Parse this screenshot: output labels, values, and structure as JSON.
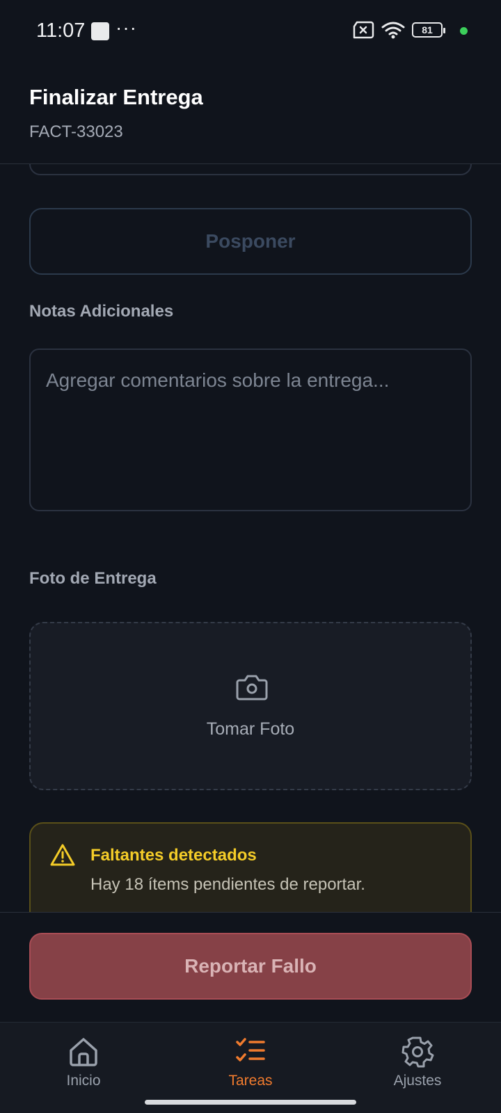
{
  "status_bar": {
    "time": "11:07",
    "dots": "···",
    "battery_level": "81",
    "icons": [
      "notification-square-icon",
      "sim-off-icon",
      "wifi-icon",
      "battery-icon",
      "dot-indicator-icon"
    ]
  },
  "header": {
    "title": "Finalizar Entrega",
    "subtitle": "FACT-33023"
  },
  "main": {
    "postpone_label": "Posponer",
    "notes": {
      "label": "Notas Adicionales",
      "placeholder": "Agregar comentarios sobre la entrega...",
      "value": ""
    },
    "photo": {
      "label": "Foto de Entrega",
      "button_label": "Tomar Foto",
      "icon": "camera-icon"
    },
    "warning": {
      "title": "Faltantes detectados",
      "text": "Hay 18 ítems pendientes de reportar.",
      "icon": "warning-icon",
      "color": "#f4cc28"
    }
  },
  "actions": {
    "report_label": "Reportar Fallo",
    "color": "#864147"
  },
  "bottom_nav": {
    "items": [
      {
        "label": "Inicio",
        "icon": "home-icon",
        "active": false
      },
      {
        "label": "Tareas",
        "icon": "tasks-icon",
        "active": true
      },
      {
        "label": "Ajustes",
        "icon": "gear-icon",
        "active": false
      }
    ],
    "active_color": "#f07b2e"
  }
}
